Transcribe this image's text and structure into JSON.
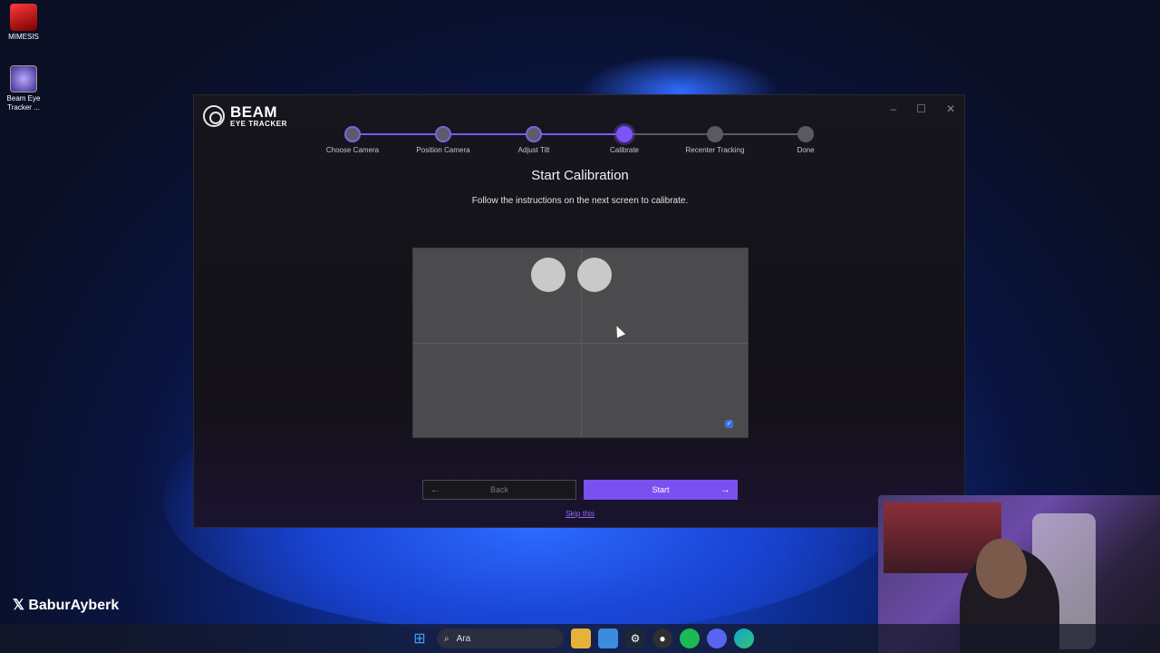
{
  "desktop": {
    "icons": [
      {
        "label": "MIMESIS",
        "icon": "game-icon"
      },
      {
        "label": "Beam Eye Tracker ...",
        "icon": "beam-icon"
      }
    ],
    "social_handle": "BaburAyberk"
  },
  "window": {
    "logo_line1": "BEAM",
    "logo_line2": "EYE TRACKER",
    "controls": {
      "minimize": "–",
      "maximize": "☐",
      "close": "✕"
    },
    "steps": [
      {
        "label": "Choose Camera",
        "state": "done"
      },
      {
        "label": "Position Camera",
        "state": "done"
      },
      {
        "label": "Adjust Tilt",
        "state": "done"
      },
      {
        "label": "Calibrate",
        "state": "active"
      },
      {
        "label": "Recenter Tracking",
        "state": "pending"
      },
      {
        "label": "Done",
        "state": "pending"
      }
    ],
    "title": "Start Calibration",
    "subtitle": "Follow the instructions on the next screen to calibrate.",
    "back_label": "Back",
    "start_label": "Start",
    "skip_label": "Skip this",
    "accent_color": "#7b50f0"
  },
  "taskbar": {
    "search_placeholder": "Ara"
  }
}
